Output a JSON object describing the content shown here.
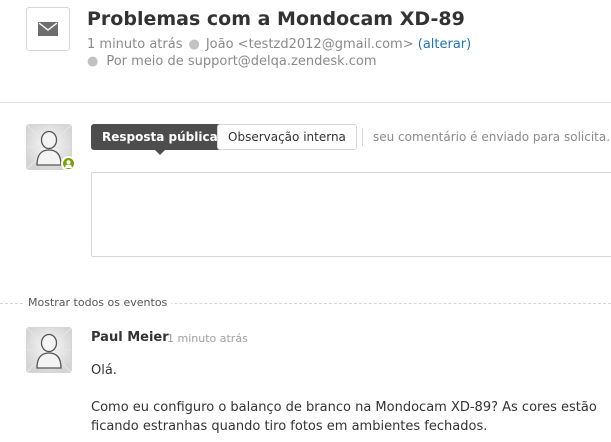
{
  "ticket": {
    "title": "Problemas com a Mondocam XD-89",
    "time_ago": "1 minuto atrás",
    "requester": "João <testzd2012@gmail.com>",
    "change_link": "(alterar)",
    "via": "Por meio de support@delqa.zendesk.com",
    "icon": "envelope-icon"
  },
  "reply": {
    "public_tab": "Resposta pública",
    "internal_tab": "Observação interna",
    "hint": "seu comentário é enviado para solicita...",
    "comment_value": ""
  },
  "events": {
    "show_all": "Mostrar todos os eventos"
  },
  "comment": {
    "author": "Paul Meier",
    "time_ago": "1 minuto atrás",
    "greeting": "Olá.",
    "body": "Como eu configuro o balanço de branco na Mondocam XD-89? As cores estão ficando estranhas quando tiro fotos em ambientes fechados."
  },
  "colors": {
    "link": "#1f73b7",
    "tab_active_bg": "#4d4d4d",
    "presence": "#78a300"
  }
}
